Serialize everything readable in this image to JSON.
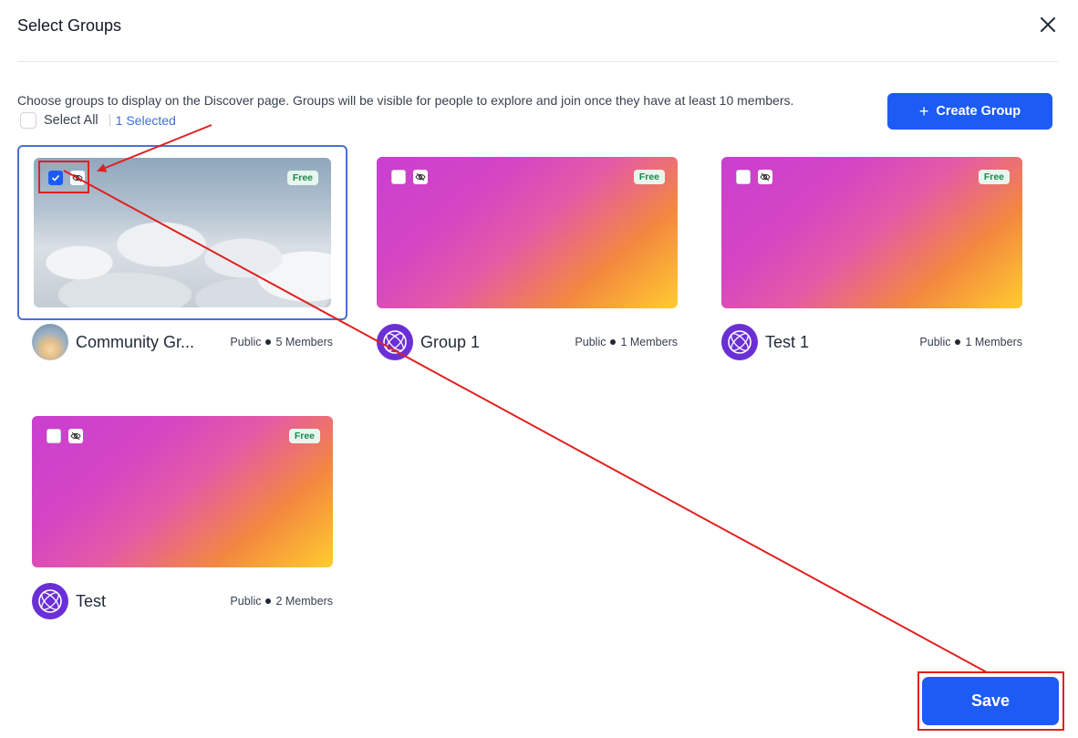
{
  "header": {
    "title": "Select Groups",
    "close_icon": "close-icon"
  },
  "toolbar": {
    "description": "Choose groups to display on the Discover page. Groups will be visible for people to explore and join once they have at least 10 members.",
    "select_all_label": "Select All",
    "selected_count": "1 Selected",
    "create_group_label": "Create Group"
  },
  "groups": [
    {
      "name": "Community Gr...",
      "privacy": "Public",
      "members": "5 Members",
      "badge": "Free",
      "cover": "clouds",
      "avatar": "photo",
      "checked": true
    },
    {
      "name": "Group 1",
      "privacy": "Public",
      "members": "1 Members",
      "badge": "Free",
      "cover": "gradient",
      "avatar": "logo",
      "checked": false
    },
    {
      "name": "Test 1",
      "privacy": "Public",
      "members": "1 Members",
      "badge": "Free",
      "cover": "gradient",
      "avatar": "logo",
      "checked": false
    },
    {
      "name": "Test",
      "privacy": "Public",
      "members": "2 Members",
      "badge": "Free",
      "cover": "gradient",
      "avatar": "logo",
      "checked": false
    }
  ],
  "footer": {
    "save_label": "Save"
  },
  "colors": {
    "primary": "#1d5bf5",
    "annotation": "#e02020",
    "avatar_logo": "#6b2fd6",
    "badge_text": "#188a4c"
  }
}
